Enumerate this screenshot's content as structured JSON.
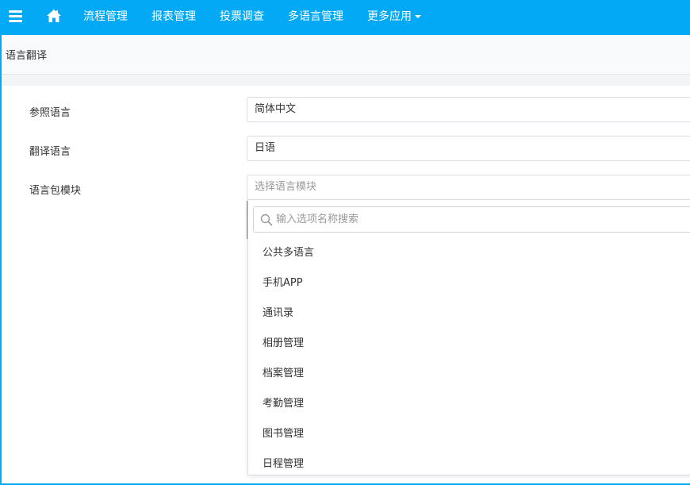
{
  "nav": {
    "items": [
      {
        "label": "流程管理"
      },
      {
        "label": "报表管理"
      },
      {
        "label": "投票调查"
      },
      {
        "label": "多语言管理"
      },
      {
        "label": "更多应用"
      }
    ],
    "icons": {
      "menu": "hamburger-icon",
      "home": "home-icon",
      "more": "caret-down-icon"
    },
    "color": "#03a9f4"
  },
  "page": {
    "title": "语言翻译"
  },
  "form": {
    "reference_language": {
      "label": "参照语言",
      "value": "简体中文"
    },
    "target_language": {
      "label": "翻译语言",
      "value": "日语"
    },
    "module": {
      "label": "语言包模块",
      "placeholder": "选择语言模块"
    }
  },
  "dropdown": {
    "search_placeholder": "输入选项名称搜索",
    "search_icon": "search-icon",
    "options": [
      "公共多语言",
      "手机APP",
      "通讯录",
      "相册管理",
      "档案管理",
      "考勤管理",
      "图书管理",
      "日程管理"
    ]
  }
}
